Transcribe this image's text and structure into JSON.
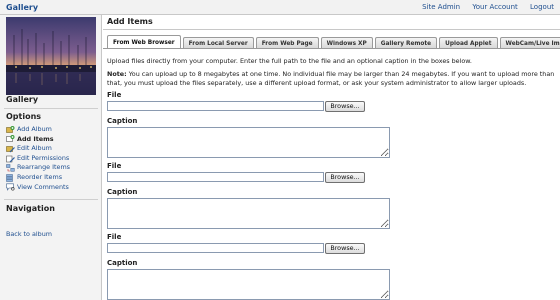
{
  "header": {
    "brand": "Gallery",
    "links": [
      "Site Admin",
      "Your Account",
      "Logout"
    ]
  },
  "sidebar": {
    "album_title": "Gallery",
    "options_heading": "Options",
    "options": [
      {
        "label": "Add Album",
        "icon": "add-album-icon"
      },
      {
        "label": "Add Items",
        "icon": "add-items-icon",
        "current": true
      },
      {
        "label": "Edit Album",
        "icon": "edit-album-icon"
      },
      {
        "label": "Edit Permissions",
        "icon": "edit-permissions-icon"
      },
      {
        "label": "Rearrange Items",
        "icon": "rearrange-items-icon"
      },
      {
        "label": "Reorder Items",
        "icon": "reorder-items-icon"
      },
      {
        "label": "View Comments",
        "icon": "view-comments-icon"
      }
    ],
    "navigation_heading": "Navigation",
    "back_link": "Back to album"
  },
  "main": {
    "title": "Add Items",
    "tabs": [
      "From Web Browser",
      "From Local Server",
      "From Web Page",
      "Windows XP",
      "Gallery Remote",
      "Upload Applet",
      "WebCam/Live Image"
    ],
    "active_tab": "From Web Browser",
    "intro": "Upload files directly from your computer. Enter the full path to the file and an optional caption in the boxes below.",
    "note_label": "Note:",
    "note_text": "You can upload up to 8 megabytes at one time. No individual file may be larger than 24 megabytes. If you want to upload more than that, you must upload the files separately, use a different upload format, or ask your system administrator to allow larger uploads.",
    "uploads": [
      {
        "file_label": "File",
        "file_value": "",
        "browse_label": "Browse...",
        "caption_label": "Caption",
        "caption_value": ""
      },
      {
        "file_label": "File",
        "file_value": "",
        "browse_label": "Browse...",
        "caption_label": "Caption",
        "caption_value": ""
      },
      {
        "file_label": "File",
        "file_value": "",
        "browse_label": "Browse...",
        "caption_label": "Caption",
        "caption_value": ""
      }
    ]
  },
  "colors": {
    "link": "#1f4f8f",
    "sidebar_bg": "#f3f3f3",
    "input_border": "#8a9ab0"
  }
}
